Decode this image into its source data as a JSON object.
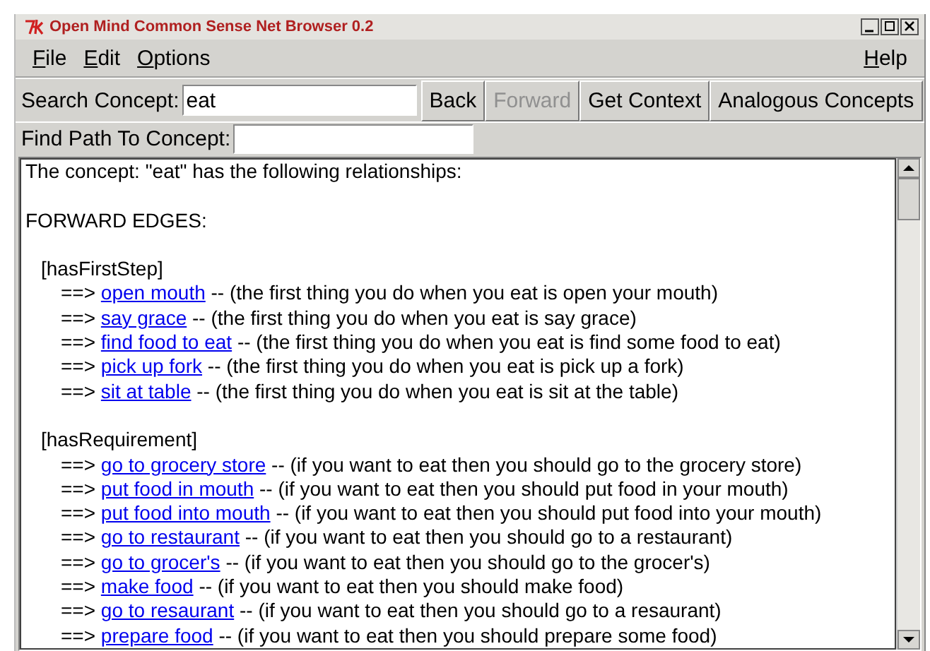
{
  "window": {
    "title": "Open Mind Common Sense Net Browser 0.2"
  },
  "menus": [
    {
      "label": "File"
    },
    {
      "label": "Edit"
    },
    {
      "label": "Options"
    }
  ],
  "help_menu": {
    "label": "Help"
  },
  "search": {
    "label": "Search Concept:",
    "value": "eat"
  },
  "buttons": [
    {
      "label": "Back",
      "disabled": false
    },
    {
      "label": "Forward",
      "disabled": true
    },
    {
      "label": "Get Context",
      "disabled": false
    },
    {
      "label": "Analogous Concepts",
      "disabled": false
    }
  ],
  "find_path": {
    "label": "Find Path To Concept:"
  },
  "content": {
    "intro": "The concept: \"eat\" has the following relationships:",
    "heading": "FORWARD EDGES:",
    "sections": [
      {
        "name": "[hasFirstStep]",
        "edges": [
          {
            "arrow": "==>",
            "link": "open mouth",
            "text": "-- (the first thing you do when you eat is open your mouth)"
          },
          {
            "arrow": "==>",
            "link": "say grace",
            "text": "-- (the first thing you do when you eat is say grace)"
          },
          {
            "arrow": "==>",
            "link": "find food to eat",
            "text": "-- (the first thing you do when you eat is find some food to eat)"
          },
          {
            "arrow": "==>",
            "link": "pick up fork",
            "text": "-- (the first thing you do when you eat is pick up a fork)"
          },
          {
            "arrow": "==>",
            "link": "sit at table",
            "text": "-- (the first thing you do when you eat is sit at the table)"
          }
        ]
      },
      {
        "name": "[hasRequirement]",
        "edges": [
          {
            "arrow": "==>",
            "link": "go to grocery store",
            "text": "-- (if you want to eat then you should go to the grocery store)"
          },
          {
            "arrow": "==>",
            "link": "put food in mouth",
            "text": "-- (if you want to eat then you should put food in your mouth)"
          },
          {
            "arrow": "==>",
            "link": "put food into mouth",
            "text": "-- (if you want to eat then you should put food into your mouth)"
          },
          {
            "arrow": "==>",
            "link": "go to restaurant",
            "text": "-- (if you want to eat then you should go to a restaurant)"
          },
          {
            "arrow": "==>",
            "link": "go to grocer's",
            "text": "-- (if you want to eat then you should go to the grocer's)"
          },
          {
            "arrow": "==>",
            "link": "make food",
            "text": "-- (if you want to eat then you should make food)"
          },
          {
            "arrow": "==>",
            "link": "go to resaurant",
            "text": "-- (if you want to eat then you should go to a resaurant)"
          },
          {
            "arrow": "==>",
            "link": "prepare food",
            "text": "-- (if you want to eat then you should prepare some food)"
          }
        ]
      }
    ]
  }
}
